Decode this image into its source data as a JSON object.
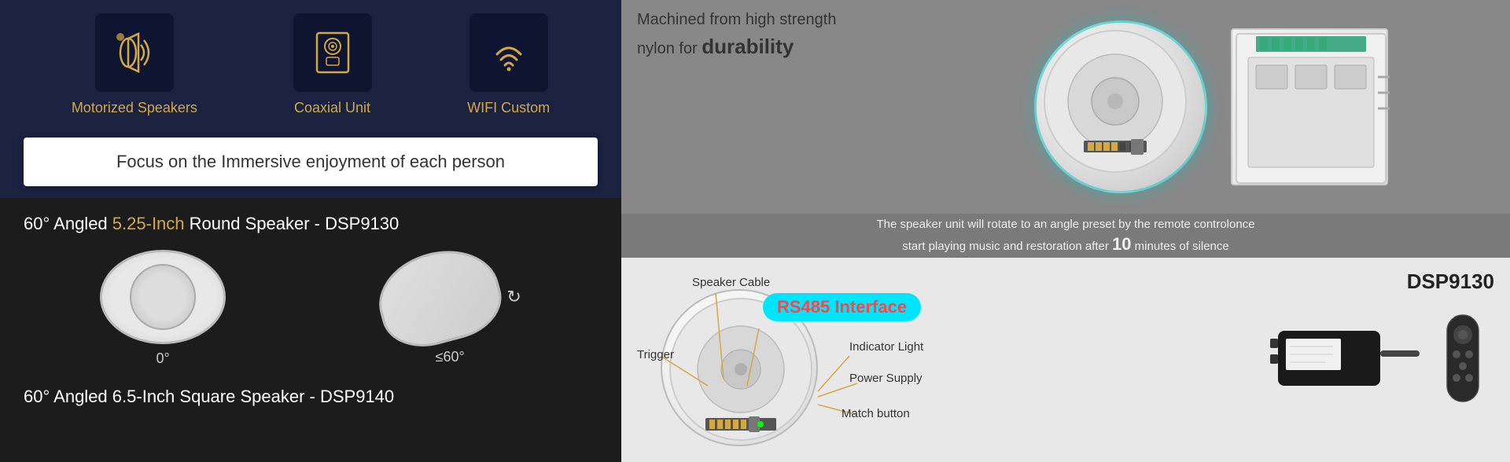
{
  "left_panel": {
    "icons": [
      {
        "id": "motorized-speakers",
        "label": "Motorized Speakers",
        "icon_type": "speaker-wave"
      },
      {
        "id": "coaxial-unit",
        "label": "Coaxial Unit",
        "icon_type": "speaker-box"
      },
      {
        "id": "wifi-custom",
        "label": "WIFI Custom",
        "icon_type": "wifi-signal"
      }
    ],
    "banner_text": "Focus on the Immersive enjoyment of each person",
    "speaker1_title_prefix": "60° Angled ",
    "speaker1_highlight": "5.25-Inch",
    "speaker1_title_suffix": " Round Speaker -  DSP9130",
    "speaker1_angle1": "0°",
    "speaker1_angle2": "≤60°",
    "speaker2_title_prefix": "60° Angled ",
    "speaker2_highlight": "6.5-Inch",
    "speaker2_title_suffix": " Square Speaker -  DSP9140"
  },
  "right_panel": {
    "top_text_line1": "Machined from high strength",
    "top_text_line2": "nylon for ",
    "top_text_bold": "durability",
    "rotate_text1": "The speaker unit will rotate to an angle preset by the remote controlonce",
    "rotate_text2_prefix": "start playing music and restoration after ",
    "rotate_text2_big": "10",
    "rotate_text2_suffix": " minutes of silence",
    "dsp_label": "DSP9130",
    "diagram": {
      "trigger_label": "Trigger",
      "speaker_cable_label": "Speaker Cable",
      "rs485_label": "RS485 Interface",
      "indicator_label": "Indicator Light",
      "power_label": "Power Supply",
      "match_label": "Match button"
    }
  }
}
